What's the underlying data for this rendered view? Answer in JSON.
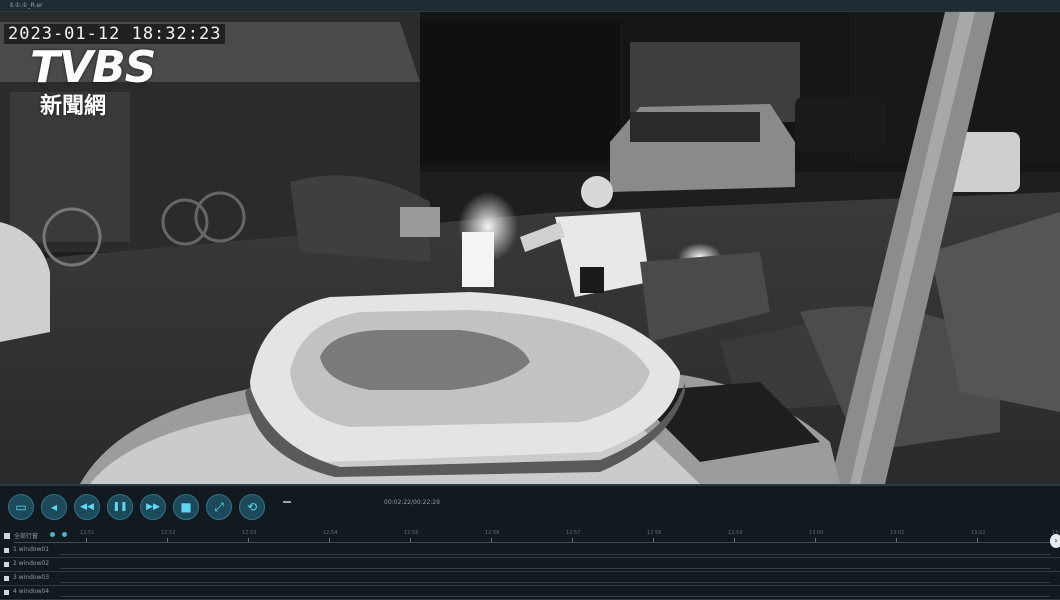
{
  "window": {
    "title": "Ⅱ.①.①_R.er"
  },
  "video": {
    "timestamp": "2023-01-12 18:32:23",
    "logo": {
      "brand": "TVBS",
      "network": "新聞網"
    }
  },
  "toolbar": {
    "buttons": [
      {
        "name": "open-folder-button",
        "icon": "folder-icon",
        "glyph": "▭"
      },
      {
        "name": "volume-button",
        "icon": "speaker-icon",
        "glyph": "◂"
      },
      {
        "name": "rewind-button",
        "icon": "rewind-icon",
        "glyph": "◀◀"
      },
      {
        "name": "pause-button",
        "icon": "pause-icon",
        "glyph": "❚❚"
      },
      {
        "name": "fast-forward-button",
        "icon": "fast-forward-icon",
        "glyph": "▶▶"
      },
      {
        "name": "stop-button",
        "icon": "stop-icon",
        "glyph": "■"
      },
      {
        "name": "fullscreen-button",
        "icon": "fullscreen-icon",
        "glyph": "⤢"
      },
      {
        "name": "loop-button",
        "icon": "loop-icon",
        "glyph": "⟲"
      }
    ],
    "playback_time": "00:02:22/00:22:29"
  },
  "timeline": {
    "all_label": "全部行窗",
    "ticks": [
      "12:51",
      "12:52",
      "12:53",
      "12:54",
      "12:55",
      "12:56",
      "12:57",
      "12:58",
      "12:59",
      "13:00",
      "13:01",
      "13:02",
      "13:03"
    ],
    "channels": [
      {
        "label": "1 window01"
      },
      {
        "label": "2 window02"
      },
      {
        "label": "3 window03"
      },
      {
        "label": "4 window04"
      }
    ]
  },
  "colors": {
    "accent": "#5fd6f2",
    "button_bg": "#1d4a5a",
    "panel_bg": "#121a1f"
  }
}
